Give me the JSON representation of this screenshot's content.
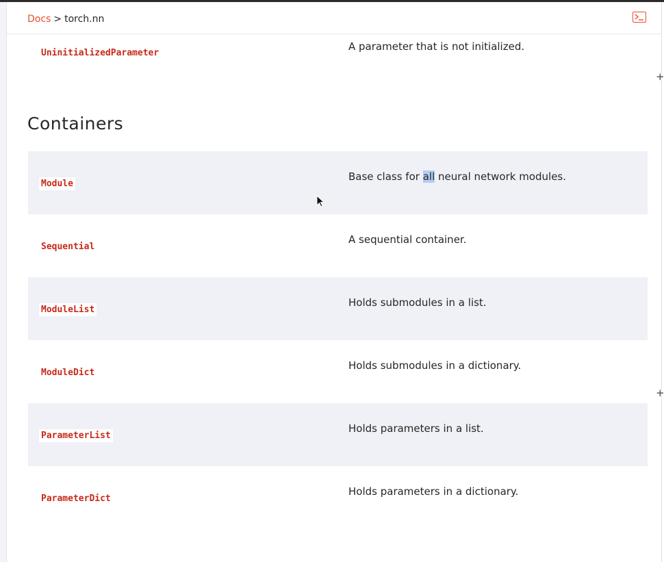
{
  "breadcrumb": {
    "docs_label": "Docs",
    "separator": ">",
    "current": "torch.nn"
  },
  "toolbar": {
    "terminal_icon": "terminal-icon"
  },
  "top_row": {
    "name": "UninitializedParameter",
    "description": "A parameter that is not initialized."
  },
  "section": {
    "title": "Containers"
  },
  "rows": [
    {
      "name": "Module",
      "description_before": "Base class for ",
      "description_highlight": "all",
      "description_after": " neural network modules."
    },
    {
      "name": "Sequential",
      "description": "A sequential container."
    },
    {
      "name": "ModuleList",
      "description": "Holds submodules in a list."
    },
    {
      "name": "ModuleDict",
      "description": "Holds submodules in a dictionary."
    },
    {
      "name": "ParameterList",
      "description": "Holds parameters in a list."
    },
    {
      "name": "ParameterDict",
      "description": "Holds parameters in a dictionary."
    }
  ],
  "expanders": [
    "+",
    "+"
  ],
  "colors": {
    "accent": "#ee4c2c",
    "code": "#c7291a",
    "row_shade": "#f0f1f6",
    "selection": "#b3cdf3"
  }
}
